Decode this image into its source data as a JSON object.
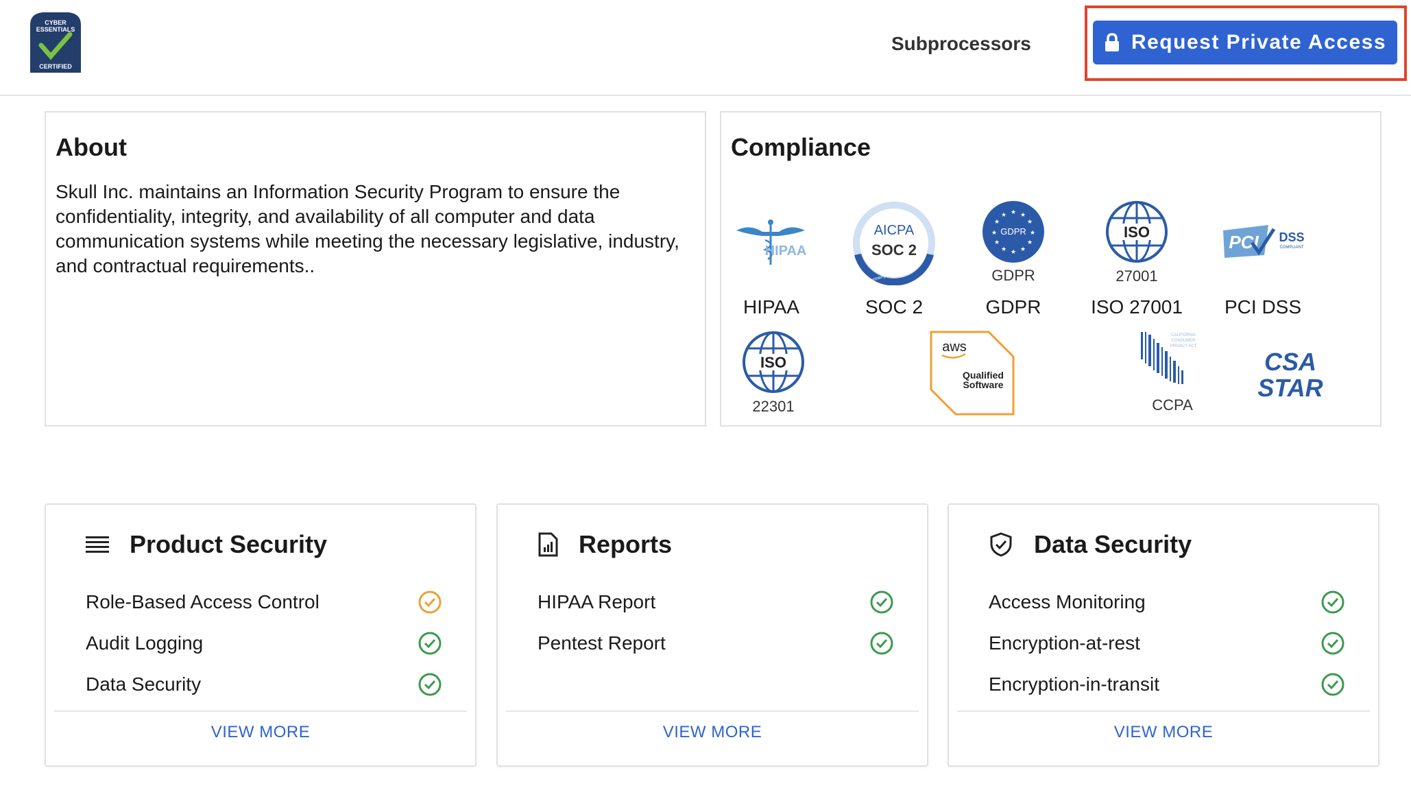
{
  "header": {
    "logo": {
      "line1": "CYBER",
      "line2": "ESSENTIALS",
      "line3": "CERTIFIED"
    },
    "nav_link": "Subprocessors",
    "cta_label": "Request Private Access"
  },
  "about": {
    "title": "About",
    "text": "Skull Inc. maintains an Information Security Program to ensure the confidentiality, integrity, and availability of all computer and data communication systems while meeting the necessary legislative, industry, and contractual requirements.."
  },
  "compliance": {
    "title": "Compliance",
    "badges": [
      {
        "label": "HIPAA",
        "logo_text": "HIPAA"
      },
      {
        "label": "SOC 2",
        "logo_text": "AICPA",
        "logo_sub": "SOC 2",
        "logo_ring": "Formerly SAS 70 Reports"
      },
      {
        "label": "GDPR",
        "logo_text": "GDPR",
        "logo_sub": "GDPR"
      },
      {
        "label": "ISO 27001",
        "logo_text": "ISO",
        "logo_sub": "27001"
      },
      {
        "label": "PCI DSS",
        "logo_text": "PCI",
        "logo_sub": "DSS",
        "logo_small": "COMPLIANT"
      }
    ],
    "badges_row2": [
      {
        "logo_text": "ISO",
        "logo_sub": "22301"
      },
      {
        "logo_text": "aws",
        "logo_sub1": "Qualified",
        "logo_sub2": "Software"
      },
      {
        "logo_text": "CCPA",
        "logo_small1": "CALIFORNIA",
        "logo_small2": "CONSUMER",
        "logo_small3": "PRIVACY ACT"
      },
      {
        "logo_text1": "CSA",
        "logo_text2": "STAR"
      }
    ]
  },
  "cards": [
    {
      "title": "Product Security",
      "icon": "list-icon",
      "items": [
        {
          "label": "Role-Based Access Control",
          "status": "pending"
        },
        {
          "label": "Audit Logging",
          "status": "ok"
        },
        {
          "label": "Data Security",
          "status": "ok"
        }
      ],
      "view_more": "VIEW MORE"
    },
    {
      "title": "Reports",
      "icon": "report-icon",
      "items": [
        {
          "label": "HIPAA Report",
          "status": "ok"
        },
        {
          "label": "Pentest Report",
          "status": "ok"
        }
      ],
      "view_more": "VIEW MORE"
    },
    {
      "title": "Data Security",
      "icon": "shield-icon",
      "items": [
        {
          "label": "Access Monitoring",
          "status": "ok"
        },
        {
          "label": "Encryption-at-rest",
          "status": "ok"
        },
        {
          "label": "Encryption-in-transit",
          "status": "ok"
        }
      ],
      "view_more": "VIEW MORE"
    }
  ],
  "colors": {
    "primary": "#2f63d1",
    "highlight_frame": "#e0442c",
    "status_ok": "#3b9a4e",
    "status_pending": "#e8a23a",
    "badge_blue": "#2b5aa8"
  }
}
